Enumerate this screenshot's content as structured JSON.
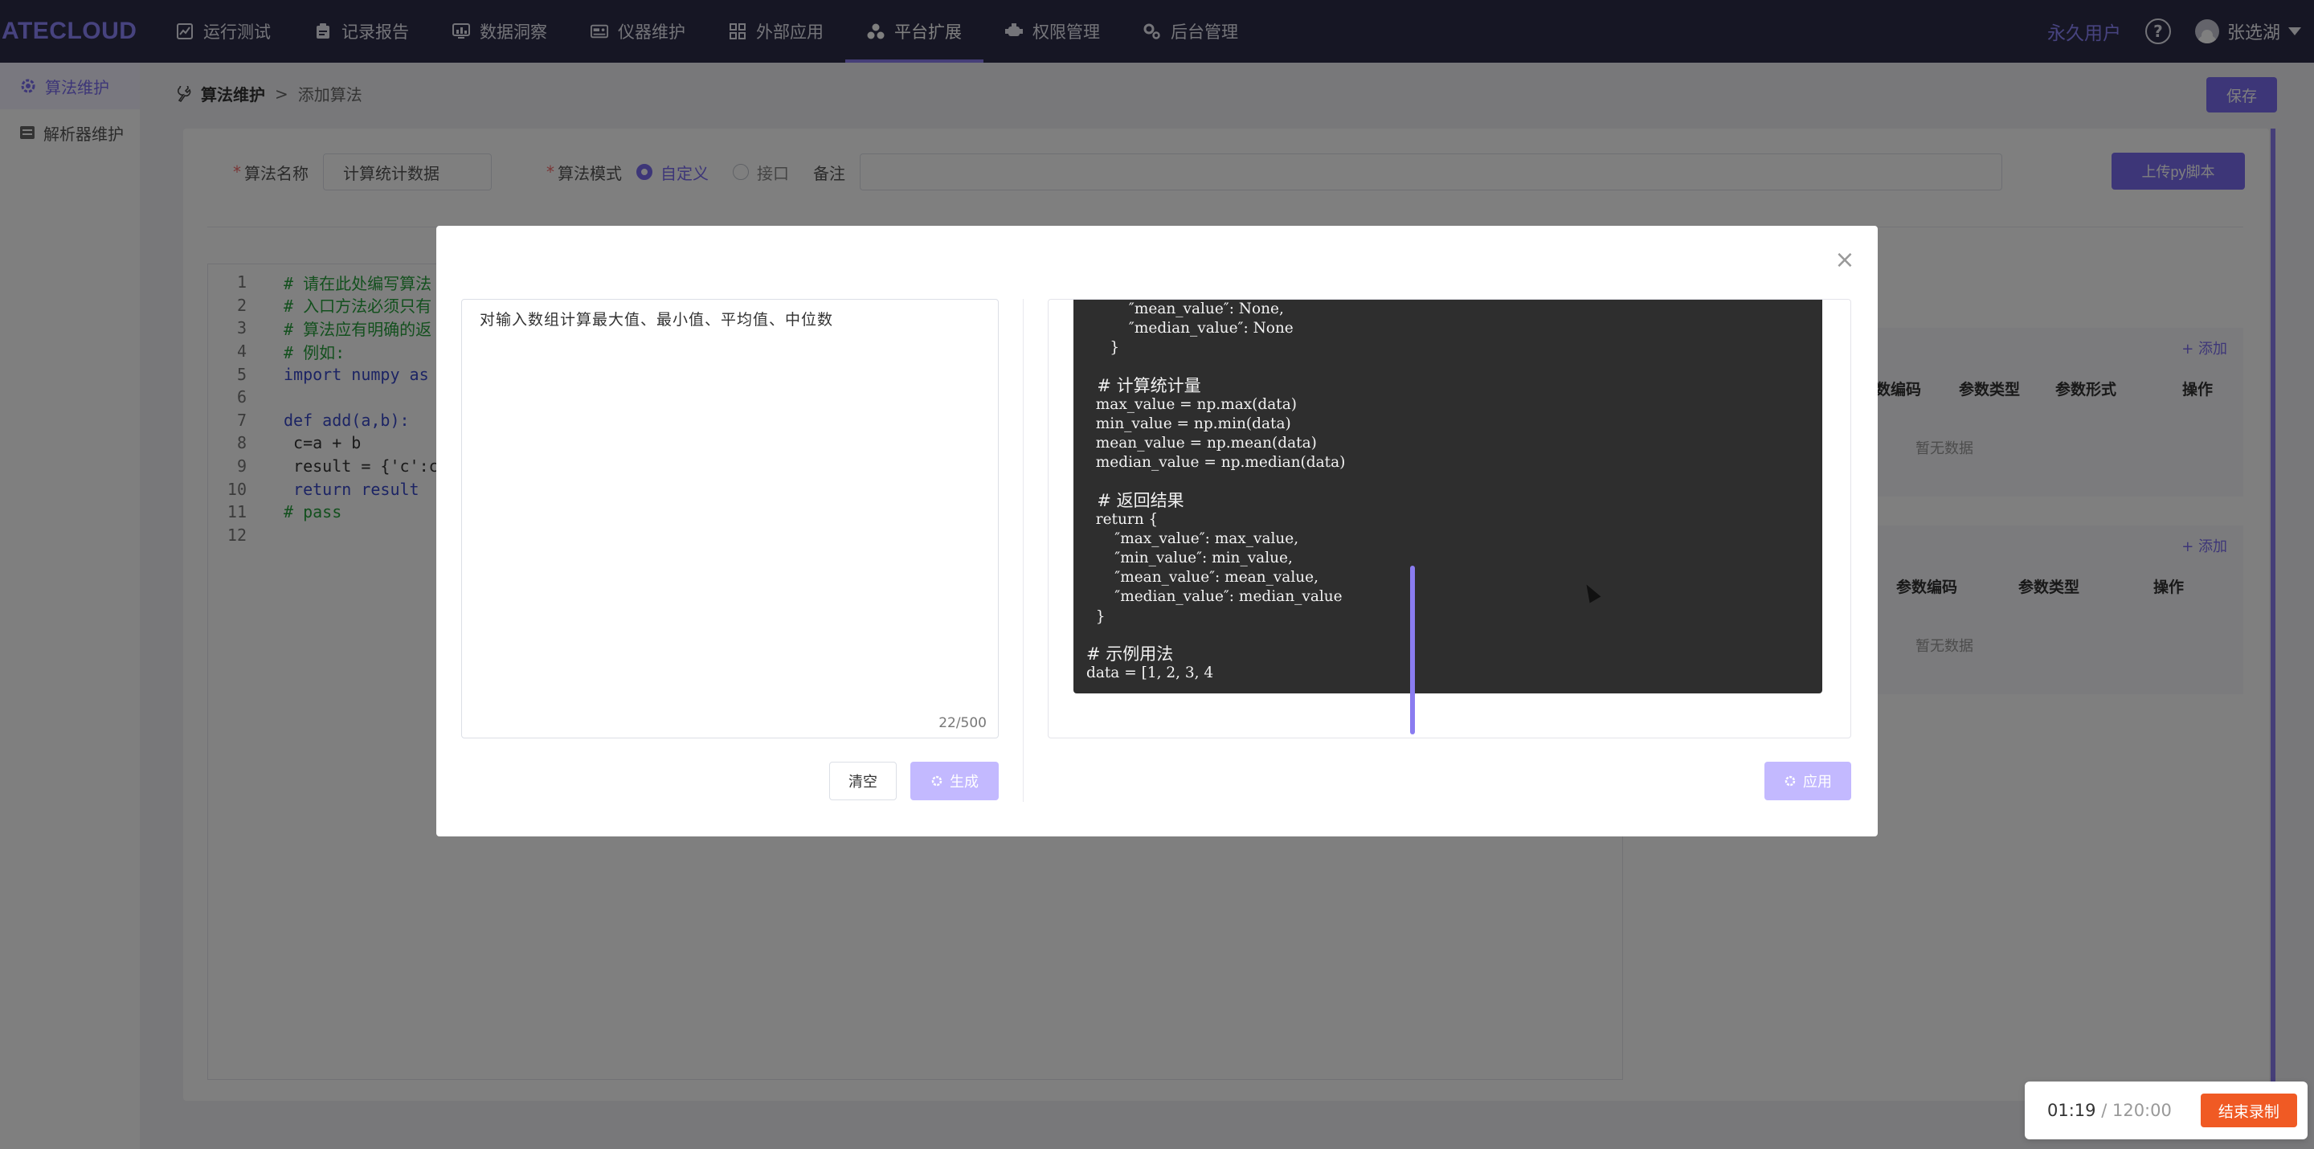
{
  "app": {
    "logo": "ATECLOUD"
  },
  "nav": {
    "items": [
      {
        "label": "运行测试",
        "icon": "chart-icon"
      },
      {
        "label": "记录报告",
        "icon": "clipboard-icon"
      },
      {
        "label": "数据洞察",
        "icon": "monitor-chart-icon"
      },
      {
        "label": "仪器维护",
        "icon": "instrument-icon"
      },
      {
        "label": "外部应用",
        "icon": "grid-icon"
      },
      {
        "label": "平台扩展",
        "icon": "cluster-icon",
        "active": true
      },
      {
        "label": "权限管理",
        "icon": "permission-icon"
      },
      {
        "label": "后台管理",
        "icon": "gears-icon"
      }
    ],
    "permanent_user": "永久用户",
    "user_name": "张选湖"
  },
  "sidebar": {
    "items": [
      {
        "label": "算法维护",
        "active": true
      },
      {
        "label": "解析器维护"
      }
    ]
  },
  "breadcrumb": {
    "first": "算法维护",
    "separator": ">",
    "current": "添加算法"
  },
  "toolbar": {
    "save_label": "保存"
  },
  "form": {
    "name_label": "算法名称",
    "name_value": "计算统计数据",
    "mode_label": "算法模式",
    "mode_options": [
      "自定义",
      "接口"
    ],
    "note_label": "备注",
    "upload_label": "上传py脚本"
  },
  "editor": {
    "lines": [
      {
        "n": "1",
        "text": "# 请在此处编写算法",
        "type": "comment"
      },
      {
        "n": "2",
        "text": "# 入口方法必须只有",
        "type": "comment"
      },
      {
        "n": "3",
        "text": "# 算法应有明确的返",
        "type": "comment"
      },
      {
        "n": "4",
        "text": "# 例如:",
        "type": "comment"
      },
      {
        "n": "5",
        "text": "import numpy as",
        "type": "import"
      },
      {
        "n": "6",
        "text": "",
        "type": "plain"
      },
      {
        "n": "7",
        "text": "def add(a,b):",
        "type": "def"
      },
      {
        "n": "8",
        "text": " c=a + b",
        "type": "plain"
      },
      {
        "n": "9",
        "text": " result = {'c':c",
        "type": "plain"
      },
      {
        "n": "10",
        "text": " return result",
        "type": "return"
      },
      {
        "n": "11",
        "text": "# pass",
        "type": "comment"
      },
      {
        "n": "12",
        "text": "",
        "type": "plain"
      }
    ]
  },
  "params": {
    "input": {
      "add_label": "+ 添加",
      "headers": [
        "数编码",
        "参数类型",
        "参数形式",
        "操作"
      ],
      "empty": "暂无数据"
    },
    "output": {
      "add_label": "+ 添加",
      "headers": [
        "参数编码",
        "参数类型",
        "操作"
      ],
      "empty": "暂无数据"
    }
  },
  "modal": {
    "prompt_text": "对输入数组计算最大值、最小值、平均值、中位数",
    "counter": "22/500",
    "clear_label": "清空",
    "generate_label": "生成",
    "apply_label": "应用",
    "code_lines": [
      {
        "text": "         ″mean_value″: None,",
        "zh": false
      },
      {
        "text": "         ″median_value″: None",
        "zh": false
      },
      {
        "text": "     }",
        "zh": false
      },
      {
        "text": "",
        "gap": true
      },
      {
        "text": "  # 计算统计量",
        "zh": true
      },
      {
        "text": "  max_value = np.max(data)",
        "zh": false
      },
      {
        "text": "  min_value = np.min(data)",
        "zh": false
      },
      {
        "text": "  mean_value = np.mean(data)",
        "zh": false
      },
      {
        "text": "  median_value = np.median(data)",
        "zh": false
      },
      {
        "text": "",
        "gap": true
      },
      {
        "text": "  # 返回结果",
        "zh": true
      },
      {
        "text": "  return {",
        "zh": false
      },
      {
        "text": "      ″max_value″: max_value,",
        "zh": false
      },
      {
        "text": "      ″min_value″: min_value,",
        "zh": false
      },
      {
        "text": "      ″mean_value″: mean_value,",
        "zh": false
      },
      {
        "text": "      ″median_value″: median_value",
        "zh": false
      },
      {
        "text": "  }",
        "zh": false
      },
      {
        "text": "",
        "gap": true
      },
      {
        "text": "# 示例用法",
        "zh": true
      },
      {
        "text": "data = [1, 2, 3, 4",
        "zh": false
      }
    ]
  },
  "recording": {
    "elapsed": "01:19",
    "separator": " / ",
    "total": "120:00",
    "stop_label": "结束录制"
  },
  "colors": {
    "accent": "#7b6df0",
    "nav_bg": "#2c2d48",
    "stop": "#f05a24"
  }
}
